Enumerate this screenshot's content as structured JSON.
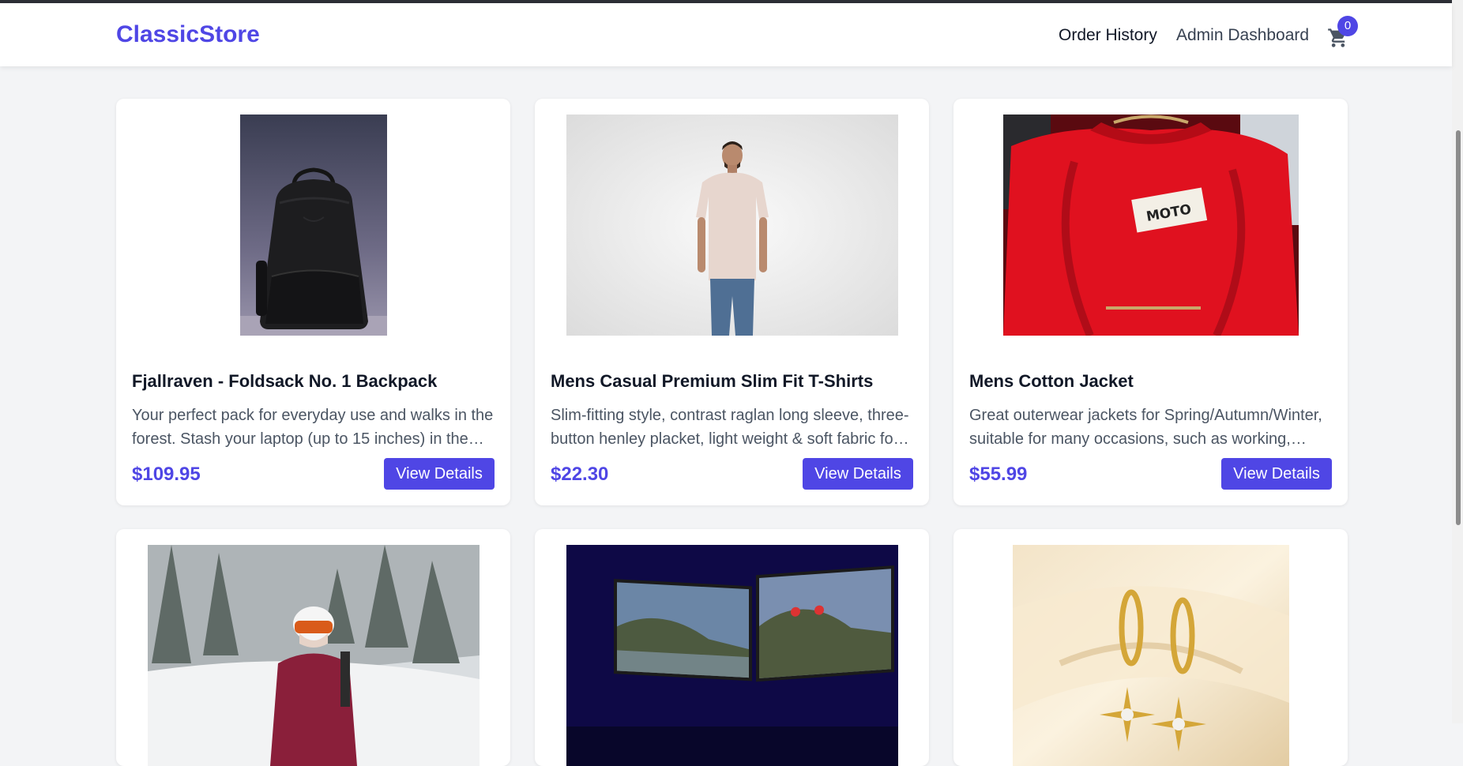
{
  "header": {
    "logo": "ClassicStore",
    "nav": {
      "order_history": "Order History",
      "admin_dashboard": "Admin Dashboard"
    },
    "cart_count": "0",
    "cart_icon": "shopping-cart-icon",
    "accent_color": "#4f46e5"
  },
  "products": [
    {
      "title": "Fjallraven - Foldsack No. 1 Backpack",
      "description": "Your perfect pack for everyday use and walks in the forest. Stash your laptop (up to 15 inches) in the…",
      "price": "$109.95",
      "button": "View Details",
      "image": "backpack-photo"
    },
    {
      "title": "Mens Casual Premium Slim Fit T-Shirts",
      "description": "Slim-fitting style, contrast raglan long sleeve, three-button henley placket, light weight & soft fabric fo…",
      "price": "$22.30",
      "button": "View Details",
      "image": "man-tshirt-photo"
    },
    {
      "title": "Mens Cotton Jacket",
      "description": "Great outerwear jackets for Spring/Autumn/Winter, suitable for many occasions, such as working,…",
      "price": "$55.99",
      "button": "View Details",
      "image": "red-jacket-photo",
      "image_label": "MOTO"
    },
    {
      "image": "skier-photo"
    },
    {
      "image": "monitors-photo"
    },
    {
      "image": "earrings-photo"
    }
  ]
}
